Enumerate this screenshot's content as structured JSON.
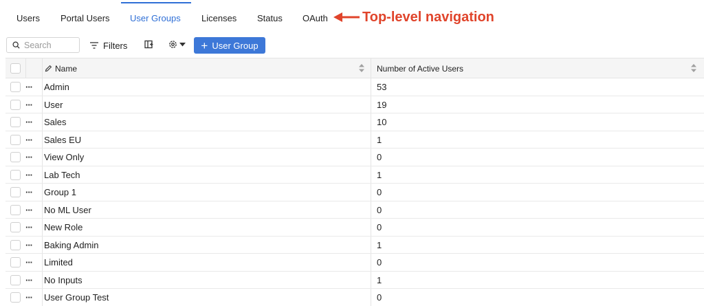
{
  "nav": {
    "tabs": [
      {
        "label": "Users"
      },
      {
        "label": "Portal Users"
      },
      {
        "label": "User Groups"
      },
      {
        "label": "Licenses"
      },
      {
        "label": "Status"
      },
      {
        "label": "OAuth"
      }
    ],
    "active_tab": "User Groups",
    "annotation": "Top-level navigation"
  },
  "toolbar": {
    "search_placeholder": "Search",
    "filters_label": "Filters",
    "add_label": "User Group"
  },
  "table": {
    "columns": [
      "Name",
      "Number of Active Users"
    ],
    "rows": [
      {
        "name": "Admin",
        "count": "53"
      },
      {
        "name": "User",
        "count": "19"
      },
      {
        "name": "Sales",
        "count": "10"
      },
      {
        "name": "Sales EU",
        "count": "1"
      },
      {
        "name": "View Only",
        "count": "0"
      },
      {
        "name": "Lab Tech",
        "count": "1"
      },
      {
        "name": "Group 1",
        "count": "0"
      },
      {
        "name": "No ML User",
        "count": "0"
      },
      {
        "name": "New Role",
        "count": "0"
      },
      {
        "name": "Baking Admin",
        "count": "1"
      },
      {
        "name": "Limited",
        "count": "0"
      },
      {
        "name": "No Inputs",
        "count": "1"
      },
      {
        "name": "User Group Test",
        "count": "0"
      }
    ]
  },
  "colors": {
    "accent": "#2f6fd6",
    "button": "#3d78d8",
    "annotation": "#e0442b"
  }
}
